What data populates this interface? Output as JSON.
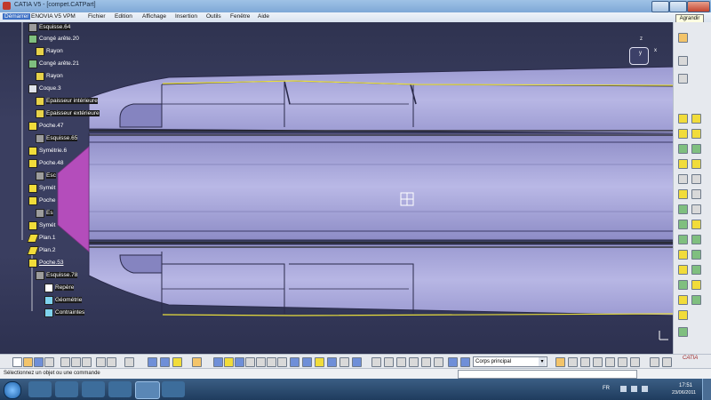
{
  "window": {
    "title": "CATIA V5 - [compet.CATPart]",
    "tooltip": "Agrandir"
  },
  "menu": [
    "Démarrer",
    "ENOVIA V5 VPM",
    "Fichier",
    "Edition",
    "Affichage",
    "Insertion",
    "Outils",
    "Fenêtre",
    "Aide"
  ],
  "tree": [
    {
      "label": "Esquisse.64",
      "kind": "sketch"
    },
    {
      "label": "Congé arête.20",
      "kind": "fillet"
    },
    {
      "label": "Rayon",
      "kind": "param"
    },
    {
      "label": "Congé arête.21",
      "kind": "fillet"
    },
    {
      "label": "Rayon",
      "kind": "param"
    },
    {
      "label": "Coque.3",
      "kind": "shell"
    },
    {
      "label": "Epaisseur intérieure",
      "kind": "param"
    },
    {
      "label": "Epaisseur extérieure",
      "kind": "param"
    },
    {
      "label": "Poche.47",
      "kind": "pocket"
    },
    {
      "label": "Esquisse.65",
      "kind": "sketch"
    },
    {
      "label": "Symétrie.6",
      "kind": "symmetry"
    },
    {
      "label": "Poche.48",
      "kind": "pocket"
    },
    {
      "label": "Esc",
      "kind": "sketch"
    },
    {
      "label": "Symét",
      "kind": "symmetry"
    },
    {
      "label": "Poche",
      "kind": "pocket"
    },
    {
      "label": "Es",
      "kind": "sketch"
    },
    {
      "label": "Symét",
      "kind": "symmetry"
    },
    {
      "label": "Plan.1",
      "kind": "plane"
    },
    {
      "label": "Plan.2",
      "kind": "plane"
    },
    {
      "label": "Poche.53",
      "kind": "pocket"
    },
    {
      "label": "Esquisse.78",
      "kind": "sketch"
    },
    {
      "label": "Repère",
      "kind": "axis"
    },
    {
      "label": "Géométrie",
      "kind": "geometry"
    },
    {
      "label": "Contraintes",
      "kind": "constraints"
    }
  ],
  "compass": {
    "x": "x",
    "y": "y",
    "z": "z"
  },
  "body_selector": "Corps principal",
  "status_text": "Sélectionnez un objet ou une commande",
  "taskbar": {
    "lang": "FR",
    "time": "17:51",
    "date": "23/06/2011"
  },
  "logo": "CATIA"
}
